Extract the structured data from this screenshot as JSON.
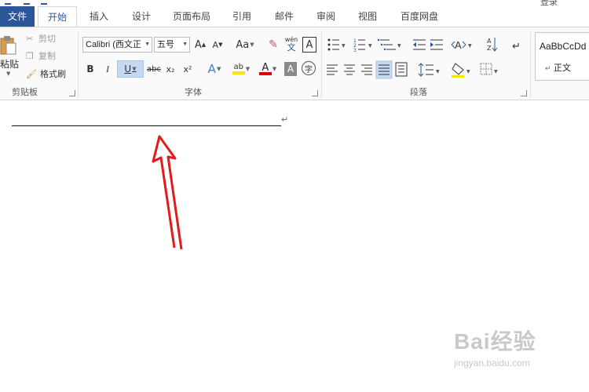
{
  "title_bar": {
    "user_name": "登录"
  },
  "tabs": [
    {
      "label": "文件"
    },
    {
      "label": "开始"
    },
    {
      "label": "插入"
    },
    {
      "label": "设计"
    },
    {
      "label": "页面布局"
    },
    {
      "label": "引用"
    },
    {
      "label": "邮件"
    },
    {
      "label": "审阅"
    },
    {
      "label": "视图"
    },
    {
      "label": "百度网盘"
    }
  ],
  "clipboard": {
    "paste_label": "粘贴",
    "cut_label": "剪切",
    "copy_label": "复制",
    "format_painter_label": "格式刷",
    "group_label": "剪贴板"
  },
  "font": {
    "font_name": "Calibri (西文正",
    "font_size": "五号",
    "grow_glyph": "A",
    "shrink_glyph": "A",
    "change_case_label": "Aa",
    "pinyin_top": "wén",
    "pinyin_bottom": "文",
    "border_char_glyph": "A",
    "bold_glyph": "B",
    "italic_glyph": "I",
    "underline_glyph": "U",
    "strike_glyph": "abc",
    "subscript_glyph": "x₂",
    "superscript_glyph": "x²",
    "text_effect_glyph": "A",
    "highlight_glyph": "ab",
    "font_color_glyph": "A",
    "char_shading_glyph": "A",
    "enclose_char_glyph": "字",
    "group_label": "字体",
    "highlight_color": "#f7e600",
    "font_color": "#e00000"
  },
  "paragraph": {
    "group_label": "段落"
  },
  "styles": {
    "sample_text": "AaBbCcDd",
    "style_name": "正文"
  },
  "document": {
    "paragraph_mark": "↵"
  },
  "watermark": {
    "brand": "Bai经验",
    "url": "jingyan.baidu.com"
  },
  "annotation": {
    "arrow_color": "#e31b1b"
  }
}
